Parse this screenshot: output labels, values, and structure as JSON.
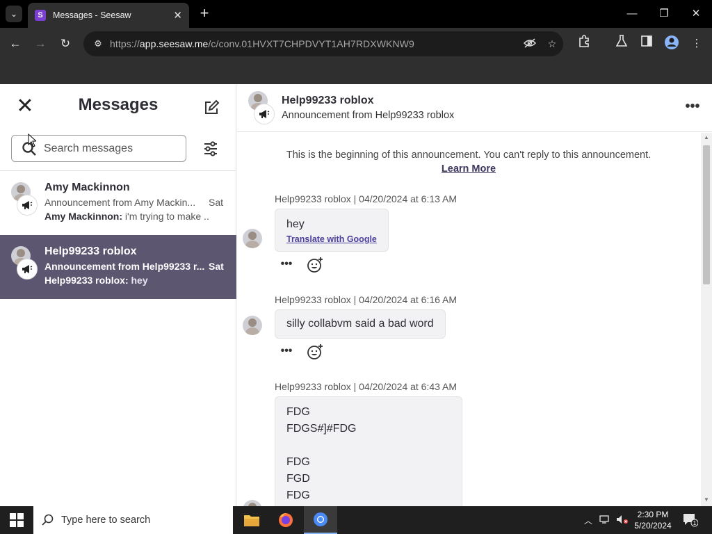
{
  "browser": {
    "tab_title": "Messages - Seesaw",
    "favicon_letter": "S",
    "url_prefix": "https://",
    "url_host": "app.seesaw.me",
    "url_path": "/c/conv.01HVXT7CHPDVYT1AH7RDXWKNW9"
  },
  "sidebar": {
    "title": "Messages",
    "search_placeholder": "Search messages",
    "conversations": [
      {
        "name": "Amy Mackinnon",
        "preview": "Announcement from Amy Mackin...",
        "date": "Sat",
        "last_sender": "Amy Mackinnon:",
        "last_text": " i'm trying to make ...",
        "selected": false
      },
      {
        "name": "Help99233 roblox",
        "preview": "Announcement from Help99233 r...",
        "date": "Sat",
        "last_sender": "Help99233 roblox:",
        "last_text": " hey",
        "selected": true
      }
    ]
  },
  "conversation": {
    "name": "Help99233 roblox",
    "subtitle": "Announcement from Help99233 roblox",
    "intro": "This is the beginning of this announcement. You can't reply to this announcement.",
    "learn_more": "Learn More",
    "messages": [
      {
        "meta": "Help99233 roblox | 04/20/2024 at 6:13 AM",
        "text": "hey",
        "translate": "Translate with Google"
      },
      {
        "meta": "Help99233 roblox | 04/20/2024 at 6:16 AM",
        "text": "silly collabvm said a bad word"
      },
      {
        "meta": "Help99233 roblox | 04/20/2024 at 6:43 AM",
        "text": "FDG\nFDGS#]#FDG\n\nFDG\nFGD\nFDG"
      }
    ]
  },
  "taskbar": {
    "search_placeholder": "Type here to search",
    "time": "2:30 PM",
    "date": "5/20/2024",
    "notification_count": "1"
  }
}
